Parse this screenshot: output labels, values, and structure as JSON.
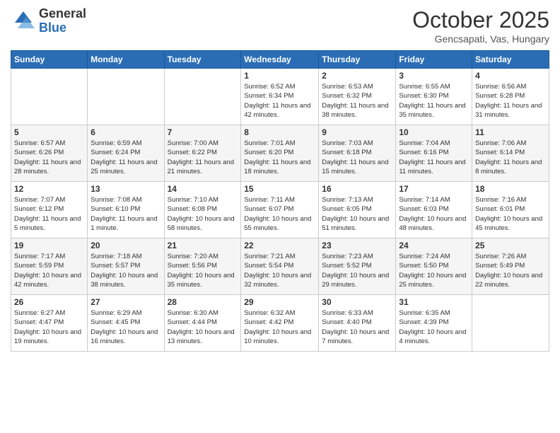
{
  "logo": {
    "general": "General",
    "blue": "Blue"
  },
  "header": {
    "month": "October 2025",
    "location": "Gencsapati, Vas, Hungary"
  },
  "days_of_week": [
    "Sunday",
    "Monday",
    "Tuesday",
    "Wednesday",
    "Thursday",
    "Friday",
    "Saturday"
  ],
  "weeks": [
    [
      {
        "day": "",
        "info": ""
      },
      {
        "day": "",
        "info": ""
      },
      {
        "day": "",
        "info": ""
      },
      {
        "day": "1",
        "info": "Sunrise: 6:52 AM\nSunset: 6:34 PM\nDaylight: 11 hours\nand 42 minutes."
      },
      {
        "day": "2",
        "info": "Sunrise: 6:53 AM\nSunset: 6:32 PM\nDaylight: 11 hours\nand 38 minutes."
      },
      {
        "day": "3",
        "info": "Sunrise: 6:55 AM\nSunset: 6:30 PM\nDaylight: 11 hours\nand 35 minutes."
      },
      {
        "day": "4",
        "info": "Sunrise: 6:56 AM\nSunset: 6:28 PM\nDaylight: 11 hours\nand 31 minutes."
      }
    ],
    [
      {
        "day": "5",
        "info": "Sunrise: 6:57 AM\nSunset: 6:26 PM\nDaylight: 11 hours\nand 28 minutes."
      },
      {
        "day": "6",
        "info": "Sunrise: 6:59 AM\nSunset: 6:24 PM\nDaylight: 11 hours\nand 25 minutes."
      },
      {
        "day": "7",
        "info": "Sunrise: 7:00 AM\nSunset: 6:22 PM\nDaylight: 11 hours\nand 21 minutes."
      },
      {
        "day": "8",
        "info": "Sunrise: 7:01 AM\nSunset: 6:20 PM\nDaylight: 11 hours\nand 18 minutes."
      },
      {
        "day": "9",
        "info": "Sunrise: 7:03 AM\nSunset: 6:18 PM\nDaylight: 11 hours\nand 15 minutes."
      },
      {
        "day": "10",
        "info": "Sunrise: 7:04 AM\nSunset: 6:16 PM\nDaylight: 11 hours\nand 11 minutes."
      },
      {
        "day": "11",
        "info": "Sunrise: 7:06 AM\nSunset: 6:14 PM\nDaylight: 11 hours\nand 8 minutes."
      }
    ],
    [
      {
        "day": "12",
        "info": "Sunrise: 7:07 AM\nSunset: 6:12 PM\nDaylight: 11 hours\nand 5 minutes."
      },
      {
        "day": "13",
        "info": "Sunrise: 7:08 AM\nSunset: 6:10 PM\nDaylight: 11 hours\nand 1 minute."
      },
      {
        "day": "14",
        "info": "Sunrise: 7:10 AM\nSunset: 6:08 PM\nDaylight: 10 hours\nand 58 minutes."
      },
      {
        "day": "15",
        "info": "Sunrise: 7:11 AM\nSunset: 6:07 PM\nDaylight: 10 hours\nand 55 minutes."
      },
      {
        "day": "16",
        "info": "Sunrise: 7:13 AM\nSunset: 6:05 PM\nDaylight: 10 hours\nand 51 minutes."
      },
      {
        "day": "17",
        "info": "Sunrise: 7:14 AM\nSunset: 6:03 PM\nDaylight: 10 hours\nand 48 minutes."
      },
      {
        "day": "18",
        "info": "Sunrise: 7:16 AM\nSunset: 6:01 PM\nDaylight: 10 hours\nand 45 minutes."
      }
    ],
    [
      {
        "day": "19",
        "info": "Sunrise: 7:17 AM\nSunset: 5:59 PM\nDaylight: 10 hours\nand 42 minutes."
      },
      {
        "day": "20",
        "info": "Sunrise: 7:18 AM\nSunset: 5:57 PM\nDaylight: 10 hours\nand 38 minutes."
      },
      {
        "day": "21",
        "info": "Sunrise: 7:20 AM\nSunset: 5:56 PM\nDaylight: 10 hours\nand 35 minutes."
      },
      {
        "day": "22",
        "info": "Sunrise: 7:21 AM\nSunset: 5:54 PM\nDaylight: 10 hours\nand 32 minutes."
      },
      {
        "day": "23",
        "info": "Sunrise: 7:23 AM\nSunset: 5:52 PM\nDaylight: 10 hours\nand 29 minutes."
      },
      {
        "day": "24",
        "info": "Sunrise: 7:24 AM\nSunset: 5:50 PM\nDaylight: 10 hours\nand 25 minutes."
      },
      {
        "day": "25",
        "info": "Sunrise: 7:26 AM\nSunset: 5:49 PM\nDaylight: 10 hours\nand 22 minutes."
      }
    ],
    [
      {
        "day": "26",
        "info": "Sunrise: 6:27 AM\nSunset: 4:47 PM\nDaylight: 10 hours\nand 19 minutes."
      },
      {
        "day": "27",
        "info": "Sunrise: 6:29 AM\nSunset: 4:45 PM\nDaylight: 10 hours\nand 16 minutes."
      },
      {
        "day": "28",
        "info": "Sunrise: 6:30 AM\nSunset: 4:44 PM\nDaylight: 10 hours\nand 13 minutes."
      },
      {
        "day": "29",
        "info": "Sunrise: 6:32 AM\nSunset: 4:42 PM\nDaylight: 10 hours\nand 10 minutes."
      },
      {
        "day": "30",
        "info": "Sunrise: 6:33 AM\nSunset: 4:40 PM\nDaylight: 10 hours\nand 7 minutes."
      },
      {
        "day": "31",
        "info": "Sunrise: 6:35 AM\nSunset: 4:39 PM\nDaylight: 10 hours\nand 4 minutes."
      },
      {
        "day": "",
        "info": ""
      }
    ]
  ]
}
